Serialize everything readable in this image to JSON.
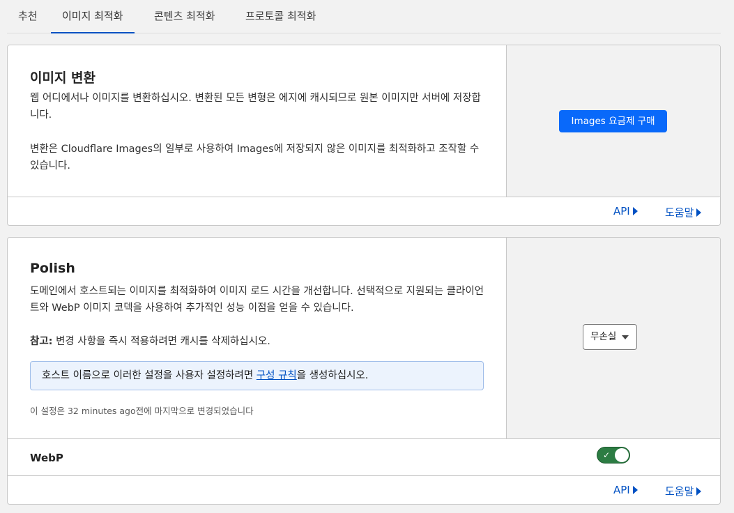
{
  "tabs": [
    "추천",
    "이미지 최적화",
    "콘텐츠 최적화",
    "프로토콜 최적화"
  ],
  "card1": {
    "title": "이미지 변환",
    "desc1": "웹 어디에서나 이미지를 변환하십시오. 변환된 모든 변형은 에지에 캐시되므로 원본 이미지만 서버에 저장합니다.",
    "desc2": "변환은 Cloudflare Images의 일부로 사용하여 Images에 저장되지 않은 이미지를 최적화하고 조작할 수 있습니다.",
    "button": "Images 요금제 구매",
    "api": "API",
    "help": "도움말"
  },
  "card2": {
    "title": "Polish",
    "desc": "도메인에서 호스트되는 이미지를 최적화하여 이미지 로드 시간을 개선합니다. 선택적으로 지원되는 클라이언트와 WebP 이미지 코덱을 사용하여 추가적인 성능 이점을 얻을 수 있습니다.",
    "note_label": "참고:",
    "note_text": " 변경 사항을 즉시 적용하려면 캐시를 삭제하십시오.",
    "notice_prefix": "호스트 이름으로 이러한 설정을 사용자 설정하려면 ",
    "notice_link": "구성 규칙",
    "notice_suffix": "을 생성하십시오.",
    "meta": "이 설정은 32 minutes ago전에 마지막으로 변경되었습니다",
    "select_value": "무손실",
    "webp_label": "WebP",
    "webp_enabled": true,
    "api": "API",
    "help": "도움말"
  },
  "colors": {
    "accent": "#0051c3",
    "button": "#0969fa",
    "toggle_on": "#2c7c43"
  }
}
